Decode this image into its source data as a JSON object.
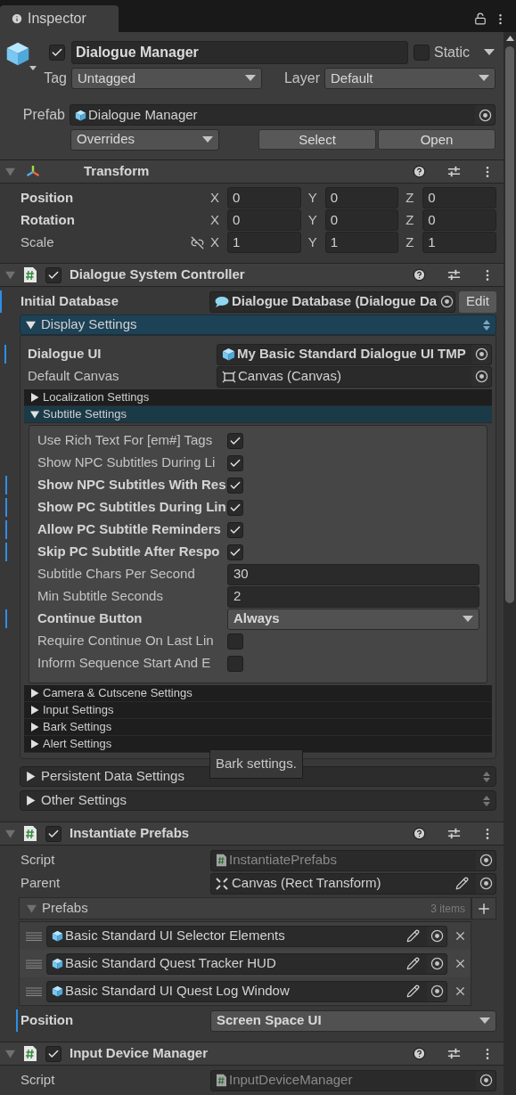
{
  "tab": {
    "label": "Inspector",
    "selected": true
  },
  "object": {
    "active": true,
    "name": "Dialogue Manager",
    "static": false,
    "static_label": "Static",
    "tag_label": "Tag",
    "tag": "Untagged",
    "layer_label": "Layer",
    "layer": "Default",
    "prefab_label": "Prefab",
    "prefab": "Dialogue Manager",
    "overrides": "Overrides",
    "buttons": [
      "Select",
      "Open"
    ]
  },
  "transform": {
    "title": "Transform",
    "expanded": true,
    "rows": [
      {
        "label": "Position",
        "bold": true,
        "link_toggle": false,
        "values": [
          {
            "axis": "X",
            "value": "0"
          },
          {
            "axis": "Y",
            "value": "0"
          },
          {
            "axis": "Z",
            "value": "0"
          }
        ]
      },
      {
        "label": "Rotation",
        "bold": true,
        "link_toggle": false,
        "values": [
          {
            "axis": "X",
            "value": "0"
          },
          {
            "axis": "Y",
            "value": "0"
          },
          {
            "axis": "Z",
            "value": "0"
          }
        ]
      },
      {
        "label": "Scale",
        "bold": false,
        "link_toggle": true,
        "values": [
          {
            "axis": "X",
            "value": "1"
          },
          {
            "axis": "Y",
            "value": "1"
          },
          {
            "axis": "Z",
            "value": "1"
          }
        ]
      }
    ]
  },
  "controller": {
    "title": "Dialogue System Controller",
    "enabled": true,
    "expanded": true,
    "initial_database": {
      "label": "Initial Database",
      "value": "Dialogue Database (Dialogue Da",
      "overridden": true,
      "button": "Edit"
    },
    "display_settings": {
      "label": "Display Settings",
      "expanded": true,
      "fields": [
        {
          "label": "Dialogue UI",
          "value": "My Basic Standard Dialogue UI TMP",
          "overridden": true
        },
        {
          "label": "Default Canvas",
          "value": "Canvas (Canvas)",
          "overridden": false
        }
      ],
      "subsections": [
        {
          "label": "Localization Settings",
          "expanded": false
        },
        {
          "label": "Subtitle Settings",
          "expanded": true,
          "fields": [
            {
              "kind": "checkbox",
              "label": "Use Rich Text For [em#] Tags",
              "overridden": false,
              "checked": true
            },
            {
              "kind": "checkbox",
              "label": "Show NPC Subtitles During Li",
              "overridden": false,
              "checked": true
            },
            {
              "kind": "checkbox",
              "label": "Show NPC Subtitles With Res",
              "overridden": true,
              "checked": true
            },
            {
              "kind": "checkbox",
              "label": "Show PC Subtitles During Lin",
              "overridden": true,
              "checked": true
            },
            {
              "kind": "checkbox",
              "label": "Allow PC Subtitle Reminders",
              "overridden": true,
              "checked": true
            },
            {
              "kind": "checkbox",
              "label": "Skip PC Subtitle After Respo",
              "overridden": true,
              "checked": true
            },
            {
              "kind": "number",
              "label": "Subtitle Chars Per Second",
              "overridden": false,
              "value": "30"
            },
            {
              "kind": "number",
              "label": "Min Subtitle Seconds",
              "overridden": false,
              "value": "2"
            },
            {
              "kind": "dropdown",
              "label": "Continue Button",
              "overridden": true,
              "value": "Always"
            },
            {
              "kind": "checkbox",
              "label": "Require Continue On Last Lin",
              "overridden": false,
              "checked": false
            },
            {
              "kind": "checkbox",
              "label": "Inform Sequence Start And E",
              "overridden": false,
              "checked": false
            }
          ]
        },
        {
          "label": "Camera & Cutscene Settings",
          "expanded": false
        },
        {
          "label": "Input Settings",
          "expanded": false
        },
        {
          "label": "Bark Settings",
          "expanded": false
        },
        {
          "label": "Alert Settings",
          "expanded": false
        }
      ]
    },
    "tooltip": "Bark settings.",
    "foldouts": [
      {
        "label": "Persistent Data Settings",
        "expanded": false
      },
      {
        "label": "Other Settings",
        "expanded": false
      }
    ]
  },
  "instantiate": {
    "title": "Instantiate Prefabs",
    "enabled": true,
    "expanded": true,
    "script": {
      "label": "Script",
      "value": "InstantiatePrefabs",
      "disabled": true
    },
    "parent": {
      "label": "Parent",
      "value": "Canvas (Rect Transform)"
    },
    "prefabs": {
      "label": "Prefabs",
      "count": "3 items",
      "expanded": true,
      "items": [
        "Basic Standard UI Selector Elements",
        "Basic Standard Quest Tracker HUD",
        "Basic Standard UI Quest Log Window"
      ]
    },
    "position": {
      "label": "Position",
      "value": "Screen Space UI",
      "overridden": true
    }
  },
  "input_manager": {
    "title": "Input Device Manager",
    "enabled": true,
    "expanded": true,
    "script": {
      "label": "Script",
      "value": "InputDeviceManager",
      "disabled": true
    }
  }
}
